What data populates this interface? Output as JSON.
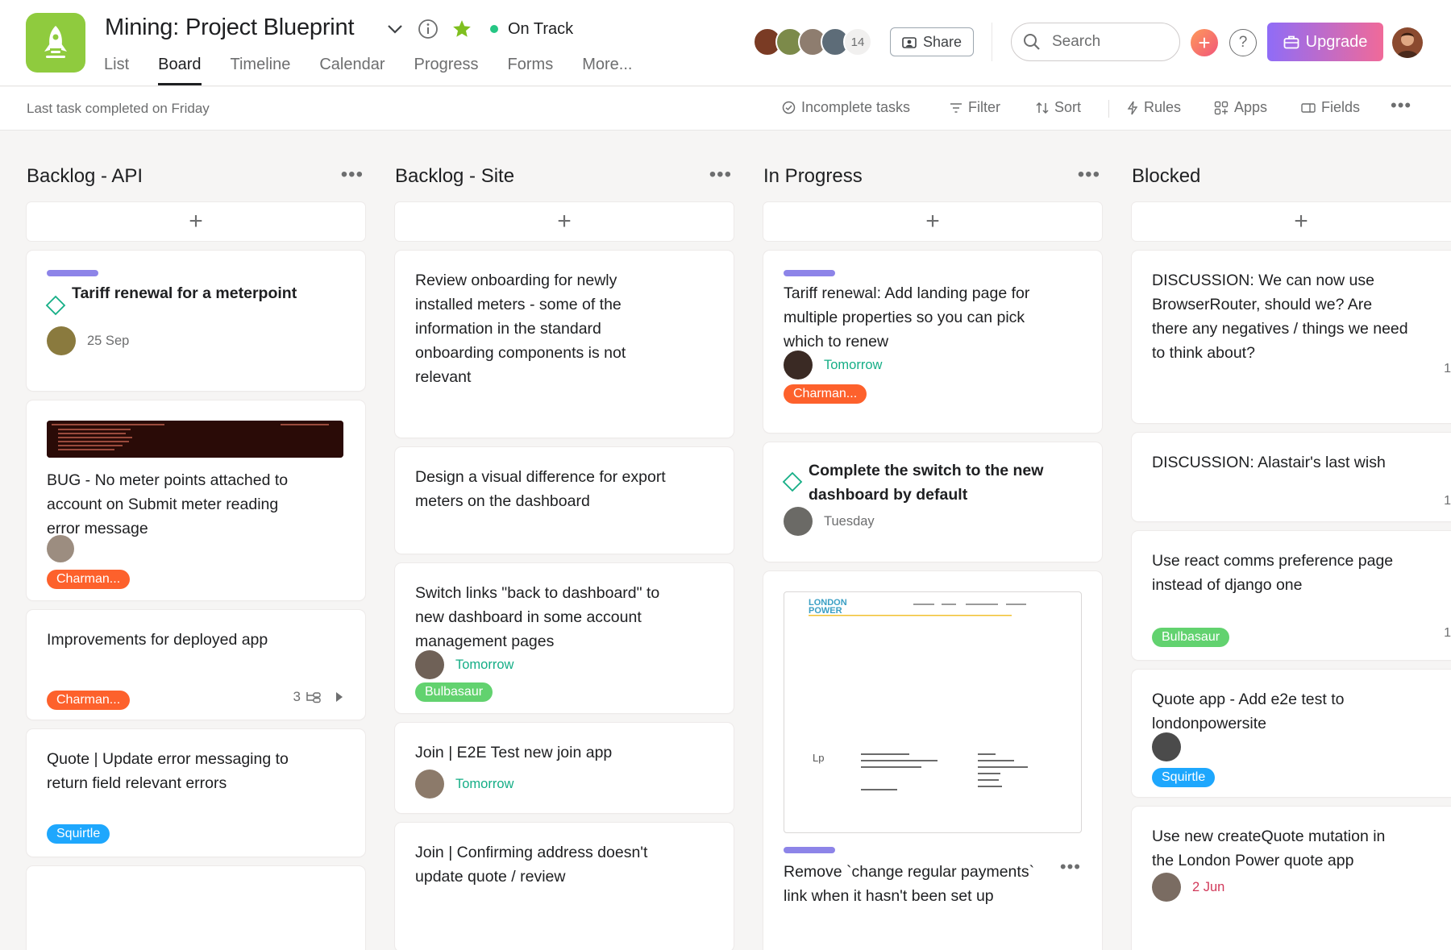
{
  "project": {
    "title": "Mining: Project Blueprint",
    "status": "On Track",
    "status_color": "#25c684",
    "icon": "rocket-icon",
    "icon_bg": "#8fcb3e"
  },
  "tabs": [
    "List",
    "Board",
    "Timeline",
    "Calendar",
    "Progress",
    "Forms",
    "More..."
  ],
  "active_tab": "Board",
  "members": {
    "count": "14"
  },
  "actions": {
    "share": "Share",
    "search_placeholder": "Search",
    "upgrade": "Upgrade"
  },
  "subbar": {
    "last_completed": "Last task completed on Friday",
    "tools": [
      "Incomplete tasks",
      "Filter",
      "Sort",
      "Rules",
      "Apps",
      "Fields"
    ]
  },
  "colors": {
    "accent_purple": "#8d84e8",
    "tag_orange": "#fd612c",
    "tag_green": "#62d26f",
    "tag_blue": "#1ea7fd",
    "date_green": "#15ae86",
    "date_red": "#d1395a",
    "upgrade_gradient": [
      "#8f6cf7",
      "#f06a99"
    ]
  },
  "columns": [
    {
      "title": "Backlog - API",
      "cards": [
        {
          "title": "Tariff renewal for a meterpoint",
          "date": "25 Sep"
        },
        {
          "title": "BUG - No meter points attached to account on Submit meter reading error message",
          "tag": "Charman..."
        },
        {
          "title": "Improvements for deployed app",
          "tag": "Charman...",
          "subtasks": "3"
        },
        {
          "title": "Quote | Update error messaging to return field relevant errors",
          "tag": "Squirtle"
        }
      ]
    },
    {
      "title": "Backlog - Site",
      "cards": [
        {
          "title": "Review onboarding for newly installed meters - some of the information in the standard onboarding components is not relevant"
        },
        {
          "title": "Design a visual difference for export meters on the dashboard"
        },
        {
          "title": "Switch links \"back to dashboard\" to new dashboard in some account management pages",
          "date": "Tomorrow",
          "tag": "Bulbasaur"
        },
        {
          "title": "Join | E2E Test new join app",
          "date": "Tomorrow"
        },
        {
          "title": "Join | Confirming address doesn't update quote / review"
        }
      ]
    },
    {
      "title": "In Progress",
      "cards": [
        {
          "title": "Tariff renewal: Add landing page for multiple properties so you can pick which to renew",
          "date": "Tomorrow",
          "tag": "Charman..."
        },
        {
          "title": "Complete the switch to the new dashboard by default",
          "date": "Tuesday"
        },
        {
          "title": "Remove `change regular payments` link when it hasn't been set up"
        }
      ]
    },
    {
      "title": "Blocked",
      "cards": [
        {
          "title": "DISCUSSION: We can now use BrowserRouter, should we? Are there any negatives / things we need to think about?",
          "comments": "1"
        },
        {
          "title": "DISCUSSION: Alastair's last wish",
          "comments": "1"
        },
        {
          "title": "Use react comms preference page instead of django one",
          "tag": "Bulbasaur",
          "comments": "1"
        },
        {
          "title": "Quote app - Add e2e test to londonpowersite",
          "tag": "Squirtle"
        },
        {
          "title": "Use new createQuote mutation in the London Power quote app",
          "date": "2 Jun"
        }
      ]
    }
  ]
}
